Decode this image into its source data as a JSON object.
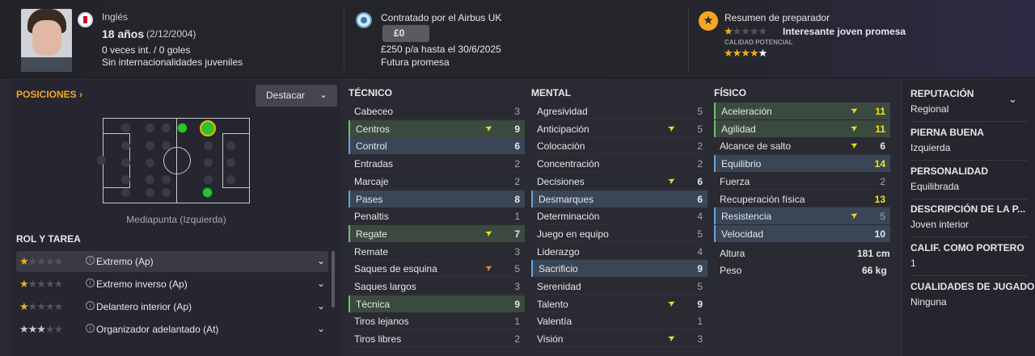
{
  "header": {
    "nationality": "Inglés",
    "age": "18 años",
    "birthdate": "(2/12/2004)",
    "caps": "0 veces int. / 0 goles",
    "youth_caps": "Sin internacionalidades juveniles",
    "contract": "Contratado por el Airbus UK",
    "value": "£0",
    "wage": "£250 p/a hasta el 30/6/2025",
    "status": "Futura promesa",
    "coach_title": "Resumen de preparador",
    "coach_summary": "Interesante joven promesa",
    "potential_label": "CALIDAD POTENCIAL",
    "current_stars": 1,
    "potential_stars": 4.5
  },
  "positions": {
    "title": "Posiciones",
    "highlight_button": "Destacar",
    "position_name": "Mediapunta (Izquierda)"
  },
  "roles": {
    "title": "ROL Y TAREA",
    "items": [
      {
        "label": "Extremo (Ap)",
        "stars": 1
      },
      {
        "label": "Extremo inverso (Ap)",
        "stars": 1
      },
      {
        "label": "Delantero interior (Ap)",
        "stars": 1
      },
      {
        "label": "Organizador adelantado (At)",
        "stars": 3
      }
    ]
  },
  "technical": {
    "title": "TÉCNICO",
    "items": [
      {
        "name": "Cabeceo",
        "value": "3",
        "hl": "plain",
        "tone": "dim"
      },
      {
        "name": "Centros",
        "value": "9",
        "hl": "green",
        "tone": "white",
        "arrow": "yellow"
      },
      {
        "name": "Control",
        "value": "6",
        "hl": "blue",
        "tone": "white"
      },
      {
        "name": "Entradas",
        "value": "2",
        "hl": "plain",
        "tone": "dim"
      },
      {
        "name": "Marcaje",
        "value": "2",
        "hl": "plain",
        "tone": "dim"
      },
      {
        "name": "Pases",
        "value": "8",
        "hl": "blue",
        "tone": "white"
      },
      {
        "name": "Penaltis",
        "value": "1",
        "hl": "plain",
        "tone": "dim"
      },
      {
        "name": "Regate",
        "value": "7",
        "hl": "green",
        "tone": "white",
        "arrow": "yellow"
      },
      {
        "name": "Remate",
        "value": "3",
        "hl": "plain",
        "tone": "dim"
      },
      {
        "name": "Saques de esquina",
        "value": "5",
        "hl": "plain",
        "tone": "dim",
        "arrow": "orange"
      },
      {
        "name": "Saques largos",
        "value": "3",
        "hl": "plain",
        "tone": "dim"
      },
      {
        "name": "Técnica",
        "value": "9",
        "hl": "green",
        "tone": "white"
      },
      {
        "name": "Tiros lejanos",
        "value": "1",
        "hl": "plain",
        "tone": "dim"
      },
      {
        "name": "Tiros libres",
        "value": "2",
        "hl": "plain",
        "tone": "dim"
      }
    ]
  },
  "mental": {
    "title": "MENTAL",
    "items": [
      {
        "name": "Agresividad",
        "value": "5",
        "hl": "plain",
        "tone": "dim"
      },
      {
        "name": "Anticipación",
        "value": "5",
        "hl": "plain",
        "tone": "dim",
        "arrow": "yellow"
      },
      {
        "name": "Colocación",
        "value": "2",
        "hl": "plain",
        "tone": "dim"
      },
      {
        "name": "Concentración",
        "value": "2",
        "hl": "plain",
        "tone": "dim"
      },
      {
        "name": "Decisiones",
        "value": "6",
        "hl": "plain",
        "tone": "white",
        "arrow": "yellow"
      },
      {
        "name": "Desmarques",
        "value": "6",
        "hl": "blue",
        "tone": "white"
      },
      {
        "name": "Determinación",
        "value": "4",
        "hl": "plain",
        "tone": "dim"
      },
      {
        "name": "Juego en equipo",
        "value": "5",
        "hl": "plain",
        "tone": "dim"
      },
      {
        "name": "Liderazgo",
        "value": "4",
        "hl": "plain",
        "tone": "dim"
      },
      {
        "name": "Sacrificio",
        "value": "9",
        "hl": "blue",
        "tone": "white"
      },
      {
        "name": "Serenidad",
        "value": "5",
        "hl": "plain",
        "tone": "dim"
      },
      {
        "name": "Talento",
        "value": "9",
        "hl": "plain",
        "tone": "white",
        "arrow": "yellow"
      },
      {
        "name": "Valentía",
        "value": "1",
        "hl": "plain",
        "tone": "dim"
      },
      {
        "name": "Visión",
        "value": "3",
        "hl": "plain",
        "tone": "dim",
        "arrow": "yellow"
      }
    ]
  },
  "physical": {
    "title": "FÍSICO",
    "items": [
      {
        "name": "Aceleración",
        "value": "11",
        "hl": "green",
        "tone": "yellow",
        "arrow": "yellow"
      },
      {
        "name": "Agilidad",
        "value": "11",
        "hl": "green",
        "tone": "yellow",
        "arrow": "yellow"
      },
      {
        "name": "Alcance de salto",
        "value": "6",
        "hl": "plain",
        "tone": "white",
        "arrow": "yellow"
      },
      {
        "name": "Equilibrio",
        "value": "14",
        "hl": "blue",
        "tone": "yellow"
      },
      {
        "name": "Fuerza",
        "value": "2",
        "hl": "plain",
        "tone": "dim"
      },
      {
        "name": "Recuperación física",
        "value": "13",
        "hl": "plain",
        "tone": "yellow"
      },
      {
        "name": "Resistencia",
        "value": "5",
        "hl": "blue",
        "tone": "dim",
        "arrow": "yellow"
      },
      {
        "name": "Velocidad",
        "value": "10",
        "hl": "blue",
        "tone": "white"
      }
    ],
    "height_label": "Altura",
    "height": "181 cm",
    "weight_label": "Peso",
    "weight": "66 kg"
  },
  "info": [
    {
      "label": "REPUTACIÓN",
      "value": "Regional"
    },
    {
      "label": "PIERNA BUENA",
      "value": "Izquierda"
    },
    {
      "label": "PERSONALIDAD",
      "value": "Equilibrada"
    },
    {
      "label": "DESCRIPCIÓN DE LA P...",
      "value": "Joven interior"
    },
    {
      "label": "CALIF. COMO PORTERO",
      "value": "1"
    },
    {
      "label": "CUALIDADES DE JUGADO",
      "value": "Ninguna"
    }
  ],
  "colors": {
    "accent": "#f5a623",
    "green_row": "#3b4a3e",
    "blue_row": "#3a4656",
    "yellow_value": "#f2e21d"
  }
}
